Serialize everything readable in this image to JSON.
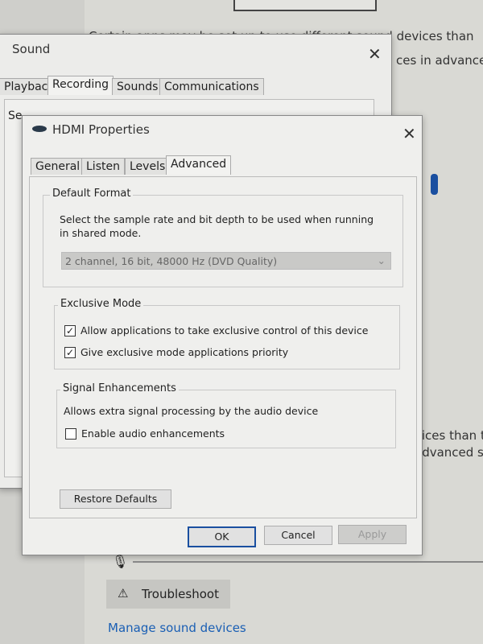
{
  "background": {
    "partial_line1": "Certain apps may be set up to use different sound devices than",
    "partial_line2": "ces in advanced",
    "partial_line3": "vices than th",
    "partial_line4": "advanced so",
    "troubleshoot_label": "Troubleshoot",
    "manage_link": "Manage sound devices"
  },
  "sound_dialog": {
    "title": "Sound",
    "tabs": [
      "Playback",
      "Recording",
      "Sounds",
      "Communications"
    ],
    "active_tab": "Recording",
    "instruction_partial": "Se"
  },
  "hdmi_dialog": {
    "title": "HDMI Properties",
    "tabs": [
      "General",
      "Listen",
      "Levels",
      "Advanced"
    ],
    "active_tab": "Advanced",
    "default_format": {
      "legend": "Default Format",
      "description_line1": "Select the sample rate and bit depth to be used when running",
      "description_line2": "in shared mode.",
      "selected_format": "2 channel, 16 bit, 48000 Hz (DVD Quality)"
    },
    "exclusive_mode": {
      "legend": "Exclusive Mode",
      "options": [
        {
          "label": "Allow applications to take exclusive control of this device",
          "checked": true
        },
        {
          "label": "Give exclusive mode applications priority",
          "checked": true
        }
      ]
    },
    "signal_enhancements": {
      "legend": "Signal Enhancements",
      "description": "Allows extra signal processing by the audio device",
      "option": {
        "label": "Enable audio enhancements",
        "checked": false
      }
    },
    "restore_defaults": "Restore Defaults",
    "ok": "OK",
    "cancel": "Cancel",
    "apply": "Apply"
  },
  "colors": {
    "link": "#1a5fb4",
    "accent": "#1a4fa0"
  }
}
